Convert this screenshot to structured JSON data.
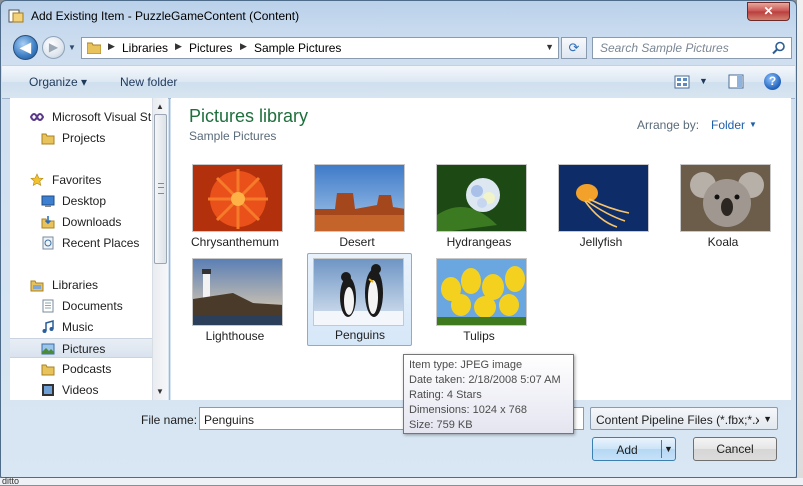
{
  "window": {
    "title": "Add Existing Item - PuzzleGameContent (Content)",
    "close_glyph": "✕"
  },
  "nav": {
    "back_glyph": "◀",
    "forward_glyph": "▶",
    "history_glyph": "▼",
    "breadcrumbs": [
      "Libraries",
      "Pictures",
      "Sample Pictures"
    ],
    "crumb_sep": "▶",
    "address_drop": "▼",
    "refresh_glyph": "⟳",
    "search_placeholder": "Search Sample Pictures"
  },
  "toolbar": {
    "organize_label": "Organize ▾",
    "new_folder_label": "New folder",
    "views_drop": "▼",
    "help_label": "?"
  },
  "navpane": {
    "items": [
      {
        "label": "Microsoft Visual St",
        "icon": "vs-icon"
      },
      {
        "label": "Projects",
        "icon": "folder-icon"
      },
      {
        "label": "Favorites",
        "icon": "star-icon"
      },
      {
        "label": "Desktop",
        "icon": "desktop-icon"
      },
      {
        "label": "Downloads",
        "icon": "downloads-icon"
      },
      {
        "label": "Recent Places",
        "icon": "recent-places-icon"
      },
      {
        "label": "Libraries",
        "icon": "libraries-icon"
      },
      {
        "label": "Documents",
        "icon": "documents-icon"
      },
      {
        "label": "Music",
        "icon": "music-icon"
      },
      {
        "label": "Pictures",
        "icon": "pictures-icon",
        "selected": true
      },
      {
        "label": "Podcasts",
        "icon": "podcasts-icon"
      },
      {
        "label": "Videos",
        "icon": "videos-icon"
      }
    ],
    "scroll_up": "▲",
    "scroll_down": "▼"
  },
  "content": {
    "library_title": "Pictures library",
    "library_subtitle": "Sample Pictures",
    "arrange_label": "Arrange by:",
    "arrange_value": "Folder",
    "arrange_drop": "▼",
    "thumbnails": [
      {
        "caption": "Chrysanthemum"
      },
      {
        "caption": "Desert"
      },
      {
        "caption": "Hydrangeas"
      },
      {
        "caption": "Jellyfish"
      },
      {
        "caption": "Koala"
      },
      {
        "caption": "Lighthouse"
      },
      {
        "caption": "Penguins",
        "selected": true
      },
      {
        "caption": "Tulips"
      }
    ]
  },
  "tooltip": {
    "lines": [
      "Item type: JPEG image",
      "Date taken: 2/18/2008 5:07 AM",
      "Rating: 4 Stars",
      "Dimensions: 1024 x 768",
      "Size: 759 KB"
    ]
  },
  "footer": {
    "file_name_label": "File name:",
    "file_name_value": "Penguins",
    "filter_value": "Content Pipeline Files (*.fbx;*.x;",
    "filter_drop": "▼",
    "add_label": "Add",
    "add_drop": "▼",
    "cancel_label": "Cancel"
  },
  "background": {
    "text": "ditto"
  },
  "colors": {
    "library_title": "#1e6f3d",
    "link_blue": "#1f5fa8",
    "selection": "#d6e7f8"
  }
}
